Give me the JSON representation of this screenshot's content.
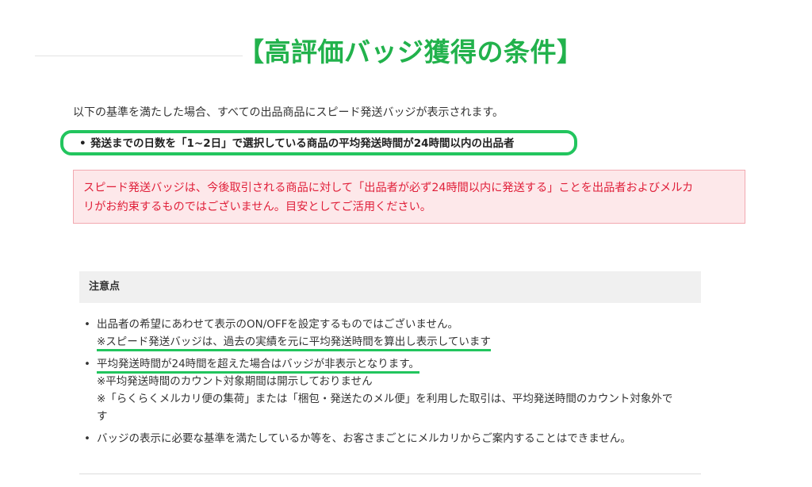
{
  "heading": "【高評価バッジ獲得の条件】",
  "intro": "以下の基準を満たした場合、すべての出品商品にスピード発送バッジが表示されます。",
  "criteria": "発送までの日数を「1~2日」で選択している商品の平均発送時間が24時間以内の出品者",
  "warning": {
    "line1": "スピード発送バッジは、今後取引される商品に対して「出品者が必ず24時間以内に発送する」ことを出品者およびメルカ",
    "line2": "リがお約束するものではございません。目安としてご活用ください。"
  },
  "notes_title": "注意点",
  "notes": [
    {
      "text": "出品者の希望にあわせて表示のON/OFFを設定するものではございません。",
      "sub": "※スピード発送バッジは、過去の実績を元に平均発送時間を算出し表示しています"
    },
    {
      "text": "平均発送時間が24時間を超えた場合はバッジが非表示となります。",
      "sub1": "※平均発送時間のカウント対象期間は開示しておりません",
      "sub2a": "※「らくらくメルカリ便の集荷」または「梱包・発送たのメル便」を利用した取引は、平均発送時間のカウント対象外で",
      "sub2b": "す"
    },
    {
      "text": "バッジの表示に必要な基準を満たしているか等を、お客さまごとにメルカリからご案内することはできません。"
    }
  ],
  "bullet": "•",
  "colors": {
    "accent_green": "#22b24c",
    "warning_red": "#e0203a",
    "warning_bg": "#fde8ea"
  }
}
